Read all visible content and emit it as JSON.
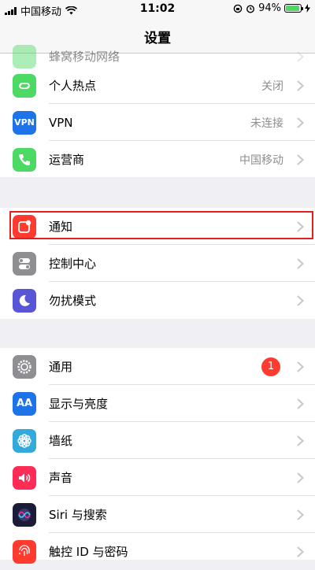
{
  "status_bar": {
    "carrier": "中国移动",
    "time": "11:02",
    "battery": "94%"
  },
  "nav": {
    "title": "设置"
  },
  "partial_row": {
    "label": "蜂窝移动网络"
  },
  "groups": [
    {
      "rows": [
        {
          "label": "个人热点",
          "detail": "关闭",
          "icon": "hotspot-icon",
          "color": "#4cd964"
        },
        {
          "label": "VPN",
          "detail": "未连接",
          "icon": "vpn-icon",
          "color": "#1e73e8",
          "icon_text": "VPN"
        },
        {
          "label": "运营商",
          "detail": "中国移动",
          "icon": "phone-icon",
          "color": "#4cd964"
        }
      ]
    },
    {
      "rows": [
        {
          "label": "通知",
          "icon": "notifications-icon",
          "color": "#ff3b30",
          "highlighted": true
        },
        {
          "label": "控制中心",
          "icon": "control-center-icon",
          "color": "#8e8e93"
        },
        {
          "label": "勿扰模式",
          "icon": "moon-icon",
          "color": "#5856d6"
        }
      ]
    },
    {
      "rows": [
        {
          "label": "通用",
          "badge": "1",
          "icon": "gear-icon",
          "color": "#8e8e93"
        },
        {
          "label": "显示与亮度",
          "icon": "text-size-icon",
          "color": "#1e73e8",
          "icon_text": "AA"
        },
        {
          "label": "墙纸",
          "icon": "wallpaper-icon",
          "color": "#34aadc"
        },
        {
          "label": "声音",
          "icon": "speaker-icon",
          "color": "#ff2d55"
        },
        {
          "label": "Siri 与搜索",
          "icon": "siri-icon",
          "color": "#1c1c3a"
        },
        {
          "label": "触控 ID 与密码",
          "icon": "fingerprint-icon",
          "color": "#ff3b30"
        }
      ]
    }
  ]
}
